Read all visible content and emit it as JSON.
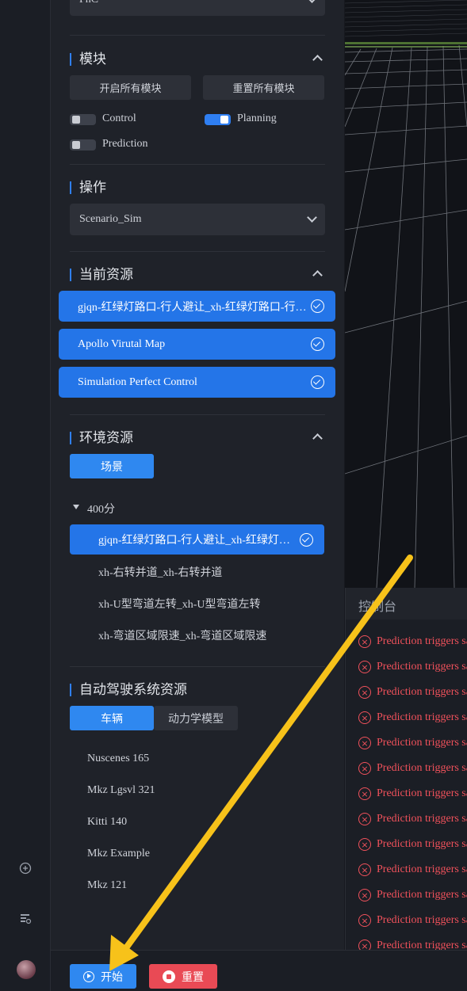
{
  "top_select": {
    "value": "PnC"
  },
  "modules": {
    "title": "模块",
    "enable_all": "开启所有模块",
    "reset_all": "重置所有模块",
    "toggles": [
      {
        "label": "Control",
        "on": false
      },
      {
        "label": "Planning",
        "on": true
      },
      {
        "label": "Prediction",
        "on": false
      }
    ]
  },
  "operation": {
    "title": "操作",
    "value": "Scenario_Sim"
  },
  "current_resources": {
    "title": "当前资源",
    "items": [
      "gjqn-红绿灯路口-行人避让_xh-红绿灯路口-行人避让",
      "Apollo Virutal Map",
      "Simulation Perfect Control"
    ]
  },
  "env_resources": {
    "title": "环境资源",
    "tab": "场景",
    "group": "400分",
    "scenarios": [
      "gjqn-红绿灯路口-行人避让_xh-红绿灯路口-行人避让",
      "xh-右转并道_xh-右转并道",
      "xh-U型弯道左转_xh-U型弯道左转",
      "xh-弯道区域限速_xh-弯道区域限速"
    ]
  },
  "ads_resources": {
    "title": "自动驾驶系统资源",
    "tabs": [
      "车辆",
      "动力学模型"
    ],
    "vehicles": [
      "Nuscenes 165",
      "Mkz Lgsvl 321",
      "Kitti 140",
      "Mkz Example",
      "Mkz 121"
    ]
  },
  "console": {
    "title": "控制台",
    "log_text": "Prediction triggers sa",
    "log_count": 13
  },
  "bottom": {
    "start": "开始",
    "reset": "重置"
  },
  "colors": {
    "accent": "#2f7ff2",
    "danger": "#e94a55",
    "annotation_arrow": "#f7c21a"
  }
}
